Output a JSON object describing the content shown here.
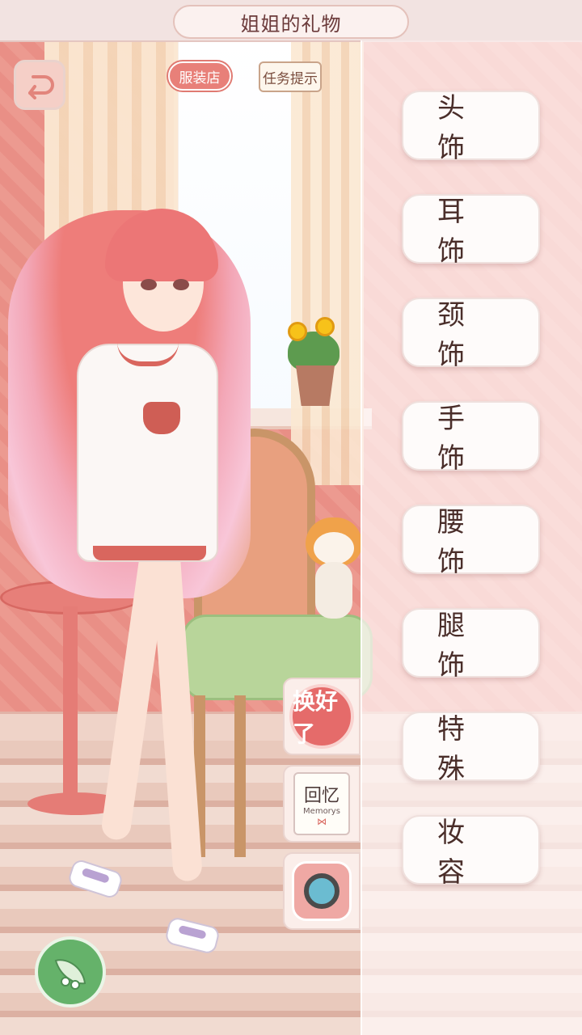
{
  "title": "姐姐的礼物",
  "top_buttons": {
    "shop": "服装店",
    "task_hint": "任务提示"
  },
  "categories": [
    {
      "label": "头饰"
    },
    {
      "label": "耳饰"
    },
    {
      "label": "颈饰"
    },
    {
      "label": "手饰"
    },
    {
      "label": "腰饰"
    },
    {
      "label": "腿饰"
    },
    {
      "label": "特殊"
    },
    {
      "label": "妆容"
    }
  ],
  "side_buttons": {
    "done": "换好了",
    "memory_title": "回忆",
    "memory_sub": "Memorys"
  },
  "icons": {
    "back": "back-arrow-icon",
    "camera": "camera-icon",
    "pea": "pea-pod-icon"
  },
  "colors": {
    "accent": "#e88079",
    "panel_text": "#4a2e2a",
    "green": "#65b26a"
  }
}
